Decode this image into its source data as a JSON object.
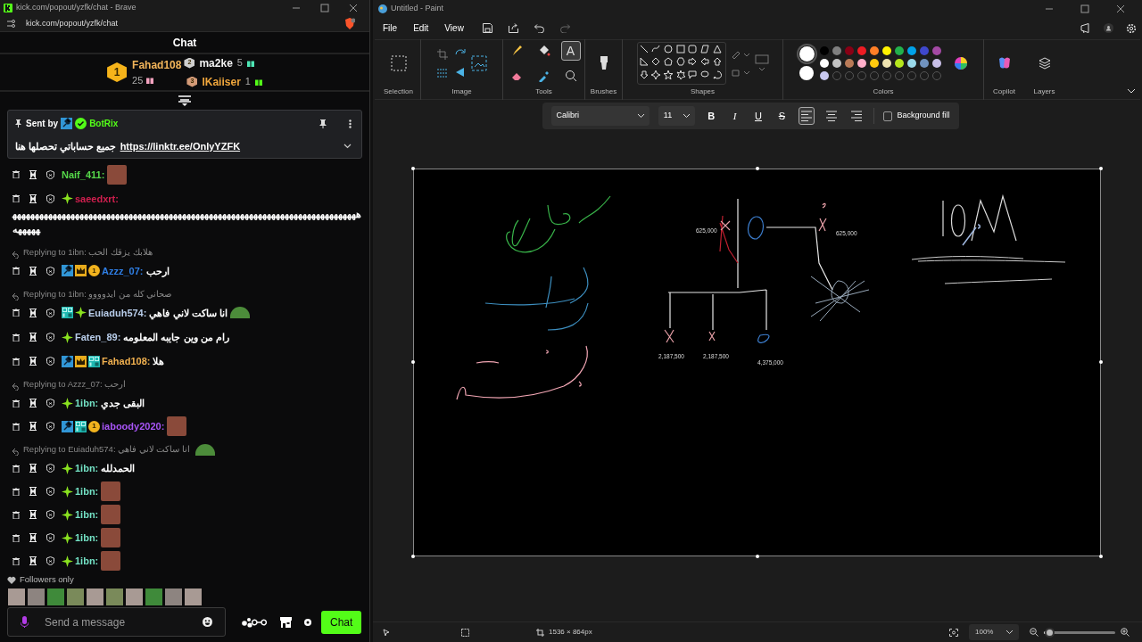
{
  "browser": {
    "title": "kick.com/popout/yzfk/chat - Brave",
    "url": "kick.com/popout/yzfk/chat"
  },
  "chat": {
    "title": "Chat",
    "leaderboard": [
      {
        "rank": "1",
        "name": "Fahad108",
        "count": "25",
        "color": "#f2b45a",
        "gift": {
          "color": "#f4a3c0"
        }
      },
      {
        "rank": "2",
        "name": "ma2ke",
        "count": "5",
        "color": "#f2f2f2",
        "gift": {
          "color": "#4ee6b5"
        }
      },
      {
        "rank": "3",
        "name": "IKaiiser",
        "count": "1",
        "color": "#f0a63c",
        "gift": {
          "color": "#53fc18"
        }
      }
    ],
    "pinned": {
      "prefix": "Sent by",
      "author": "BotRix",
      "text": "جميع حساباتي تحصلها هنا",
      "link": "https://linktr.ee/OnlyYZFK"
    },
    "messages": [
      {
        "kind": "message",
        "user": "Naif_411:",
        "color": "#56d94a",
        "emote": {
          "kind": "face"
        }
      },
      {
        "kind": "message",
        "user": "saeedxrt:",
        "color": "#d11f4f",
        "badges": [
          {
            "kind": "subscriber"
          }
        ],
        "text": "هههههههههههههههههههههههههههههههههههههههههههههههههههههههههههههههههههههههههههههههههههه"
      },
      {
        "kind": "reply",
        "target": "Replying to 1ibn:",
        "quote": "هلابك يزقك الحب"
      },
      {
        "kind": "message",
        "user": "Azzz_07:",
        "color": "#2f7fe6",
        "badges": [
          {
            "kind": "moderator"
          },
          {
            "kind": "vip"
          },
          {
            "kind": "gifter",
            "label": "1"
          }
        ],
        "text": "ارحب"
      },
      {
        "kind": "reply",
        "target": "Replying to 1ibn:",
        "quote": "صحاني كله من ايدوووو"
      },
      {
        "kind": "message",
        "user": "Euiaduh574:",
        "color": "#b8cdea",
        "badges": [
          {
            "kind": "og"
          },
          {
            "kind": "subscriber"
          }
        ],
        "text": "انا ساكت لاني فاهي",
        "emote": {
          "kind": "frog"
        }
      },
      {
        "kind": "message",
        "user": "Faten_89:",
        "color": "#b8cdea",
        "badges": [
          {
            "kind": "subscriber"
          }
        ],
        "text": "رام من وين جايبه المعلومه"
      },
      {
        "kind": "message",
        "user": "Fahad108:",
        "color": "#f0b04f",
        "badges": [
          {
            "kind": "moderator"
          },
          {
            "kind": "vip"
          },
          {
            "kind": "og"
          }
        ],
        "text": "هلا"
      },
      {
        "kind": "reply",
        "target": "Replying to Azzz_07:",
        "quote": "ارحب"
      },
      {
        "kind": "message",
        "user": "1ibn:",
        "color": "#74e3c6",
        "badges": [
          {
            "kind": "subscriber"
          }
        ],
        "text": "البقى جدي"
      },
      {
        "kind": "message",
        "user": "iaboody2020:",
        "color": "#a855f7",
        "badges": [
          {
            "kind": "moderator"
          },
          {
            "kind": "og"
          },
          {
            "kind": "gifter",
            "label": "1"
          }
        ],
        "emote": {
          "kind": "face"
        }
      },
      {
        "kind": "reply",
        "target": "Replying to Euiaduh574:",
        "quote": "انا ساكت لاني فاهي",
        "emote": {
          "kind": "frog"
        }
      },
      {
        "kind": "message",
        "user": "1ibn:",
        "color": "#74e3c6",
        "badges": [
          {
            "kind": "subscriber"
          }
        ],
        "text": "الحمدلله"
      },
      {
        "kind": "message",
        "user": "1ibn:",
        "color": "#74e3c6",
        "badges": [
          {
            "kind": "subscriber"
          }
        ],
        "emote": {
          "kind": "face"
        }
      },
      {
        "kind": "message",
        "user": "1ibn:",
        "color": "#74e3c6",
        "badges": [
          {
            "kind": "subscriber"
          }
        ],
        "emote": {
          "kind": "face"
        }
      },
      {
        "kind": "message",
        "user": "1ibn:",
        "color": "#74e3c6",
        "badges": [
          {
            "kind": "subscriber"
          }
        ],
        "emote": {
          "kind": "face"
        }
      },
      {
        "kind": "message",
        "user": "1ibn:",
        "color": "#74e3c6",
        "badges": [
          {
            "kind": "subscriber"
          }
        ],
        "emote": {
          "kind": "face"
        }
      }
    ],
    "mode": "Followers only",
    "recent_emotes": [
      {
        "kind": "face"
      },
      {
        "kind": "figure"
      },
      {
        "kind": "frog"
      },
      {
        "kind": "scene"
      },
      {
        "kind": "face"
      },
      {
        "kind": "scene"
      },
      {
        "kind": "face"
      },
      {
        "kind": "frog"
      },
      {
        "kind": "figure"
      },
      {
        "kind": "face"
      }
    ],
    "input": {
      "placeholder": "Send a message"
    },
    "send_button": "Chat"
  },
  "paint": {
    "title": "Untitled - Paint",
    "menu": [
      "File",
      "Edit",
      "View"
    ],
    "groups": [
      "Selection",
      "Image",
      "Tools",
      "Brushes",
      "Shapes",
      "Colors",
      "Copilot",
      "Layers"
    ],
    "tools": [
      {
        "kind": "pencil",
        "selected": false
      },
      {
        "kind": "fill",
        "selected": false
      },
      {
        "kind": "text",
        "label": "A",
        "selected": true
      },
      {
        "kind": "eraser",
        "selected": false
      },
      {
        "kind": "picker",
        "selected": false
      },
      {
        "kind": "magnifier",
        "selected": false
      }
    ],
    "primary": {
      "color": "#ffffff"
    },
    "secondary": {
      "color": "#ffffff"
    },
    "palette": [
      {
        "color": "#000000"
      },
      {
        "color": "#7f7f7f"
      },
      {
        "color": "#880015"
      },
      {
        "color": "#ed1c24"
      },
      {
        "color": "#ff7f27"
      },
      {
        "color": "#fff200"
      },
      {
        "color": "#22b14c"
      },
      {
        "color": "#00a2e8"
      },
      {
        "color": "#3f48cc"
      },
      {
        "color": "#a349a4"
      },
      {
        "color": "#ffffff"
      },
      {
        "color": "#c3c3c3"
      },
      {
        "color": "#b97a57"
      },
      {
        "color": "#ffaec9"
      },
      {
        "color": "#ffc90e"
      },
      {
        "color": "#efe4b0"
      },
      {
        "color": "#b5e61d"
      },
      {
        "color": "#99d9ea"
      },
      {
        "color": "#7092be"
      },
      {
        "color": "#c8bfe7"
      },
      {
        "color": "#c8c8f0"
      },
      {
        "kind": "empty"
      },
      {
        "kind": "empty"
      },
      {
        "kind": "empty"
      },
      {
        "kind": "empty"
      },
      {
        "kind": "empty"
      },
      {
        "kind": "empty"
      },
      {
        "kind": "empty"
      },
      {
        "kind": "empty"
      },
      {
        "kind": "empty"
      }
    ],
    "text_toolbar": {
      "font": "Calibri",
      "size": "11",
      "styles": [
        {
          "kind": "bold",
          "label": "B"
        },
        {
          "kind": "italic",
          "label": "I"
        },
        {
          "kind": "underline",
          "label": "U"
        },
        {
          "kind": "strike",
          "label": "S"
        }
      ],
      "align": [
        {
          "kind": "left",
          "selected": true
        },
        {
          "kind": "center",
          "selected": false
        },
        {
          "kind": "right",
          "selected": false
        }
      ],
      "background_fill": {
        "label": "Background fill",
        "checked": false
      }
    },
    "canvas_labels": [
      {
        "text": "625,000"
      },
      {
        "text": "625,000"
      },
      {
        "text": "2,187,500"
      },
      {
        "text": "2,187,500"
      },
      {
        "text": "4,375,000"
      }
    ],
    "status": {
      "size": "1536 × 864px",
      "zoom": "100%",
      "zoom_slider": {
        "level": 0.08
      }
    }
  }
}
